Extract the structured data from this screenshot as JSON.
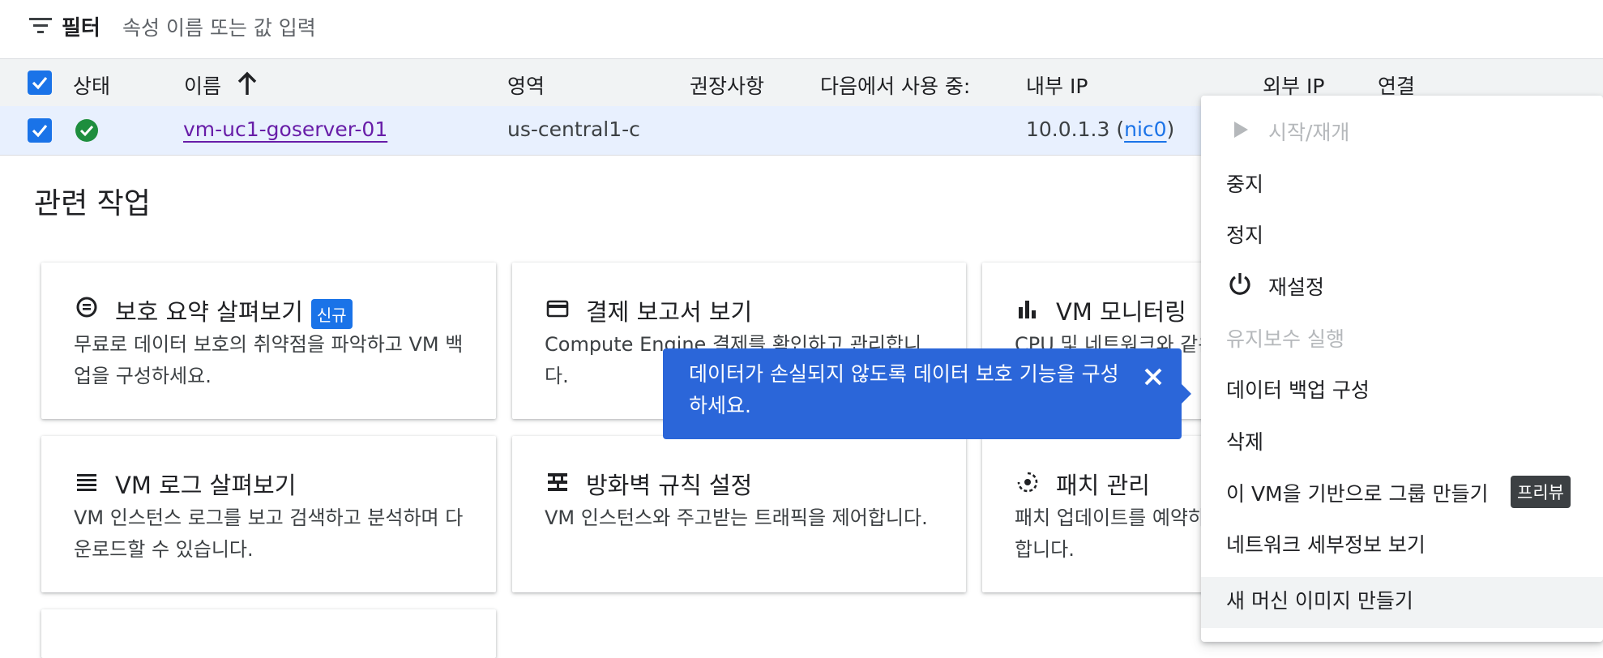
{
  "filter": {
    "label": "필터",
    "placeholder": "속성 이름 또는 값 입력"
  },
  "table": {
    "headers": [
      "상태",
      "이름",
      "영역",
      "권장사항",
      "다음에서 사용 중:",
      "내부 IP",
      "외부 IP",
      "연결"
    ],
    "sort_icon": "arrow-up-icon",
    "row": {
      "status_icon": "check-circle-icon",
      "name": "vm-uc1-goserver-01",
      "zone": "us-central1-c",
      "internal_ip": "10.0.1.3",
      "internal_ip_open": "(",
      "nic": "nic0",
      "internal_ip_close": ")"
    }
  },
  "related": {
    "title": "관련 작업",
    "cards": [
      {
        "icon": "data-protection-icon",
        "title": "보호 요약 살펴보기",
        "badge": "신규",
        "desc": "무료로 데이터 보호의 취약점을 파악하고 VM 백업을 구성하세요."
      },
      {
        "icon": "credit-card-icon",
        "title": "결제 보고서 보기",
        "desc": "Compute Engine 결제를 확인하고 관리합니다."
      },
      {
        "icon": "bar-chart-icon",
        "title": "VM 모니터링",
        "desc": "CPU 및 네트워크와 같은 측정항목을 확인합니다."
      },
      {
        "icon": "logs-icon",
        "title": "VM 로그 살펴보기",
        "desc": "VM 인스턴스 로그를 보고 검색하고 분석하며 다운로드할 수 있습니다."
      },
      {
        "icon": "firewall-icon",
        "title": "방화벽 규칙 설정",
        "desc": "VM 인스턴스와 주고받는 트래픽을 제어합니다."
      },
      {
        "icon": "patch-icon",
        "title": "패치 관리",
        "desc": "패치 업데이트를 예약하고 패치 규정 준수를 확인합니다."
      }
    ]
  },
  "tooltip": {
    "text": "데이터가 손실되지 않도록 데이터 보호 기능을 구성하세요.",
    "close_icon": "close-icon"
  },
  "menu": {
    "items": [
      {
        "label": "시작/재개",
        "icon": "play-icon",
        "disabled": true
      },
      {
        "label": "중지"
      },
      {
        "label": "정지"
      },
      {
        "label": "재설정",
        "icon": "power-icon"
      },
      {
        "label": "유지보수 실행",
        "disabled": true
      },
      {
        "label": "데이터 백업 구성"
      },
      {
        "label": "삭제"
      },
      {
        "label": "이 VM을 기반으로 그룹 만들기",
        "badge": "프리뷰"
      },
      {
        "label": "네트워크 세부정보 보기"
      },
      {
        "label": "새 머신 이미지 만들기",
        "hovered": true
      }
    ]
  },
  "colors": {
    "accent": "#1a73e8",
    "tooltip": "#2b66d9",
    "link_visited": "#681da8",
    "status_ok": "#1e8e3e"
  }
}
